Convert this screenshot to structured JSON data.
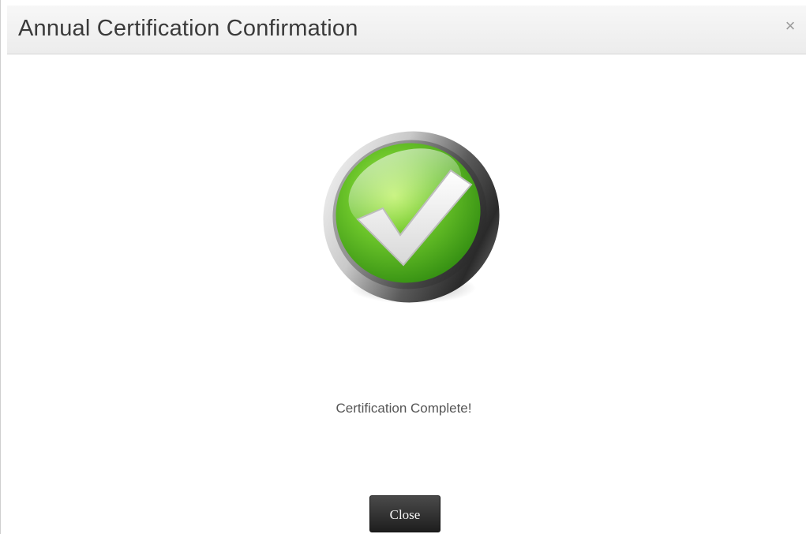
{
  "dialog": {
    "title": "Annual Certification Confirmation",
    "close_icon": "close-icon",
    "close_glyph": "×"
  },
  "status": {
    "icon": "checkmark-success-icon",
    "message": "Certification Complete!",
    "accent_color": "#5cb82a"
  },
  "actions": {
    "close_label": "Close"
  }
}
